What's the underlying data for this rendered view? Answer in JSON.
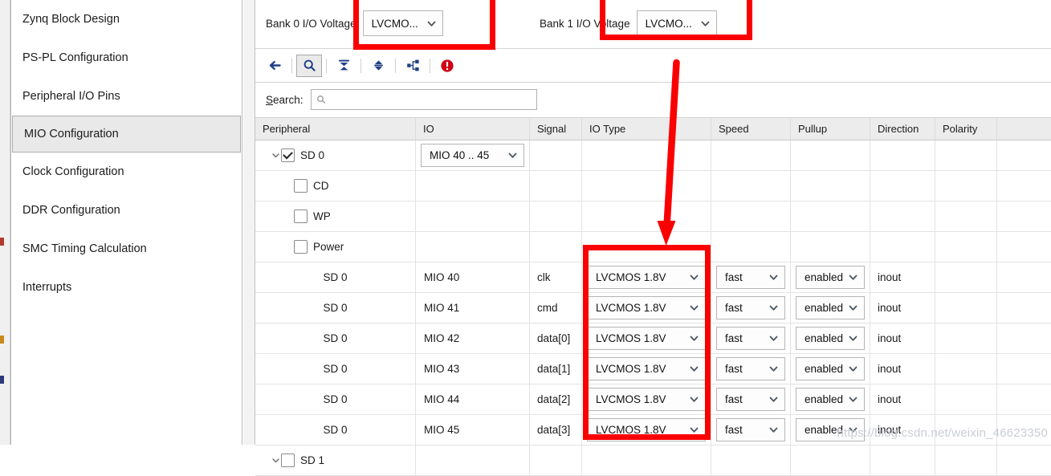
{
  "sidebar": {
    "items": [
      {
        "label": "Zynq Block Design",
        "selected": false
      },
      {
        "label": "PS-PL Configuration",
        "selected": false
      },
      {
        "label": "Peripheral I/O Pins",
        "selected": false
      },
      {
        "label": "MIO Configuration",
        "selected": true
      },
      {
        "label": "Clock Configuration",
        "selected": false
      },
      {
        "label": "DDR Configuration",
        "selected": false
      },
      {
        "label": "SMC Timing Calculation",
        "selected": false
      },
      {
        "label": "Interrupts",
        "selected": false
      }
    ]
  },
  "banks": [
    {
      "label": "Bank 0 I/O Voltage",
      "value": "LVCMO..."
    },
    {
      "label": "Bank 1 I/O Voltage",
      "value": "LVCMO..."
    }
  ],
  "toolbar": {
    "buttons": [
      {
        "icon": "back-arrow-icon",
        "pressed": false
      },
      {
        "icon": "search-icon",
        "pressed": true
      },
      {
        "icon": "collapse-all-icon",
        "pressed": false
      },
      {
        "icon": "expand-all-icon",
        "pressed": false
      },
      {
        "icon": "hierarchy-icon",
        "pressed": false
      },
      {
        "icon": "error-icon",
        "pressed": false
      }
    ]
  },
  "search": {
    "label_mnemonic": "S",
    "label_rest": "earch:",
    "value": "",
    "placeholder": ""
  },
  "table": {
    "columns": [
      "Peripheral",
      "IO",
      "Signal",
      "IO Type",
      "Speed",
      "Pullup",
      "Direction",
      "Polarity"
    ],
    "rows": [
      {
        "kind": "group",
        "peripheral": "SD 0",
        "checked": true,
        "io": "MIO 40 .. 45",
        "io_is_combo": true,
        "signal": "",
        "io_type": "",
        "speed": "",
        "pullup": "",
        "direction": "",
        "polarity": ""
      },
      {
        "kind": "child",
        "peripheral": "CD",
        "checked": false,
        "io": "",
        "io_is_combo": false,
        "signal": "",
        "io_type": "",
        "speed": "",
        "pullup": "",
        "direction": "",
        "polarity": ""
      },
      {
        "kind": "child",
        "peripheral": "WP",
        "checked": false,
        "io": "",
        "io_is_combo": false,
        "signal": "",
        "io_type": "",
        "speed": "",
        "pullup": "",
        "direction": "",
        "polarity": ""
      },
      {
        "kind": "child",
        "peripheral": "Power",
        "checked": false,
        "io": "",
        "io_is_combo": false,
        "signal": "",
        "io_type": "",
        "speed": "",
        "pullup": "",
        "direction": "",
        "polarity": ""
      },
      {
        "kind": "pin",
        "peripheral": "SD 0",
        "io": "MIO 40",
        "signal": "clk",
        "io_type": "LVCMOS 1.8V",
        "speed": "fast",
        "pullup": "enabled",
        "direction": "inout",
        "polarity": ""
      },
      {
        "kind": "pin",
        "peripheral": "SD 0",
        "io": "MIO 41",
        "signal": "cmd",
        "io_type": "LVCMOS 1.8V",
        "speed": "fast",
        "pullup": "enabled",
        "direction": "inout",
        "polarity": ""
      },
      {
        "kind": "pin",
        "peripheral": "SD 0",
        "io": "MIO 42",
        "signal": "data[0]",
        "io_type": "LVCMOS 1.8V",
        "speed": "fast",
        "pullup": "enabled",
        "direction": "inout",
        "polarity": ""
      },
      {
        "kind": "pin",
        "peripheral": "SD 0",
        "io": "MIO 43",
        "signal": "data[1]",
        "io_type": "LVCMOS 1.8V",
        "speed": "fast",
        "pullup": "enabled",
        "direction": "inout",
        "polarity": ""
      },
      {
        "kind": "pin",
        "peripheral": "SD 0",
        "io": "MIO 44",
        "signal": "data[2]",
        "io_type": "LVCMOS 1.8V",
        "speed": "fast",
        "pullup": "enabled",
        "direction": "inout",
        "polarity": ""
      },
      {
        "kind": "pin",
        "peripheral": "SD 0",
        "io": "MIO 45",
        "signal": "data[3]",
        "io_type": "LVCMOS 1.8V",
        "speed": "fast",
        "pullup": "enabled",
        "direction": "inout",
        "polarity": ""
      },
      {
        "kind": "group",
        "peripheral": "SD 1",
        "checked": false,
        "io": "",
        "io_is_combo": false,
        "signal": "",
        "io_type": "",
        "speed": "",
        "pullup": "",
        "direction": "",
        "polarity": ""
      }
    ]
  },
  "annotations": {
    "highlight_color": "#fb0000",
    "boxes": [
      {
        "name": "bank0-voltage-highlight"
      },
      {
        "name": "bank1-voltage-highlight"
      },
      {
        "name": "io-type-column-highlight"
      }
    ],
    "arrow": {
      "name": "io-type-pointer-arrow"
    }
  },
  "watermark": {
    "text": "https://blog.csdn.net/weixin_46623350"
  }
}
